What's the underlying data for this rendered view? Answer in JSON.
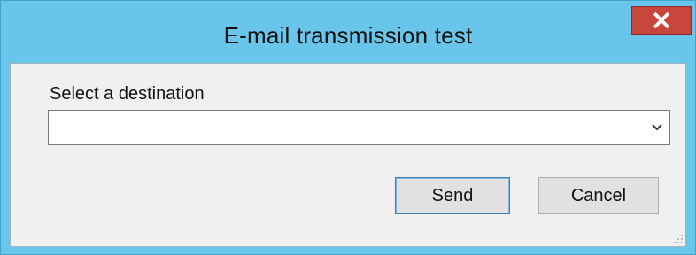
{
  "window": {
    "title": "E-mail transmission test",
    "close_glyph": "x"
  },
  "form": {
    "destination_label": "Select a destination",
    "destination_value": ""
  },
  "buttons": {
    "send_label": "Send",
    "cancel_label": "Cancel"
  },
  "icons": {
    "close": "close-icon",
    "dropdown": "chevron-down-icon",
    "resize": "resize-grip-icon"
  },
  "colors": {
    "titlebar": "#69c6ea",
    "close_button": "#c9463d",
    "client_background": "#f0f0f0",
    "default_button_border": "#3c7fb1"
  }
}
